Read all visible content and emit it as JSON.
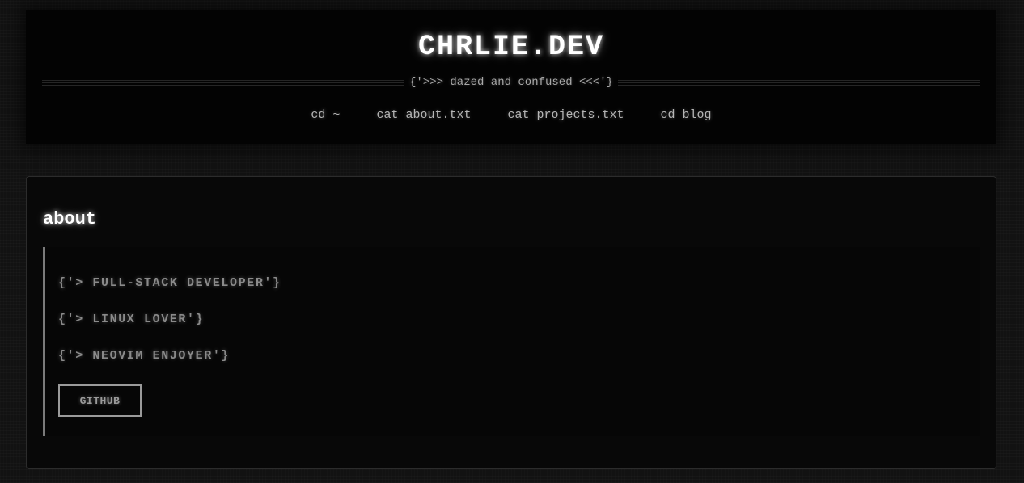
{
  "header": {
    "site_title": "CHRLIE.DEV",
    "tagline": "{'>>> dazed and confused <<<'}"
  },
  "nav": {
    "items": [
      {
        "label": "cd ~"
      },
      {
        "label": "cat about.txt"
      },
      {
        "label": "cat projects.txt"
      },
      {
        "label": "cd blog"
      }
    ]
  },
  "about": {
    "title": "about",
    "lines": [
      "{'> FULL-STACK DEVELOPER'}",
      "{'> LINUX LOVER'}",
      "{'> NEOVIM ENJOYER'}"
    ],
    "github_label": "GITHUB"
  },
  "colors": {
    "background": "#121212",
    "panel": "#030303",
    "title": "#ffffff",
    "muted_text": "#8a8a8a",
    "accent_border": "#7a7a7a"
  }
}
